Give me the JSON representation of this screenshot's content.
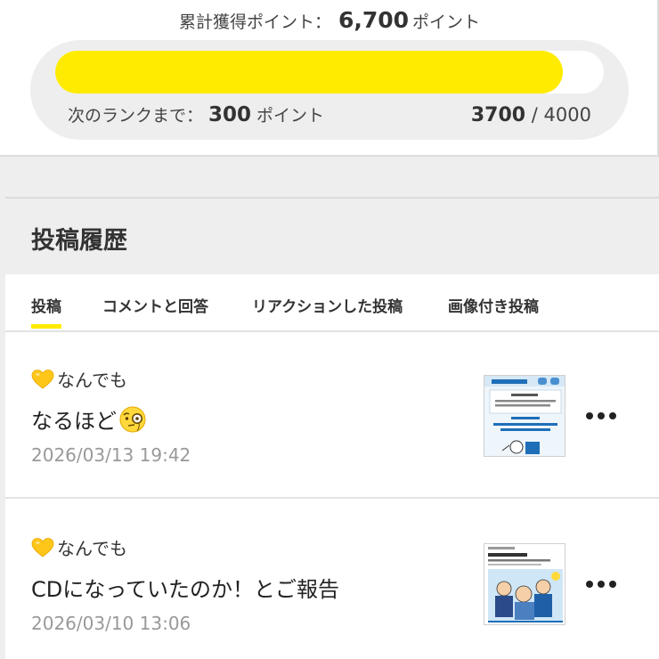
{
  "points": {
    "total_label": "累計獲得ポイント：",
    "total_value": "6,700",
    "total_unit": "ポイント",
    "next_rank_label": "次のランクまで：",
    "next_rank_value": "300",
    "next_rank_unit": "ポイント",
    "progress_current": "3700",
    "progress_separator": " / ",
    "progress_max": "4000",
    "progress_fraction": 0.925,
    "bar_color": "#ffeb00"
  },
  "history": {
    "title": "投稿履歴",
    "tabs": [
      {
        "label": "投稿",
        "active": true
      },
      {
        "label": "コメントと回答",
        "active": false
      },
      {
        "label": "リアクションした投稿",
        "active": false
      },
      {
        "label": "画像付き投稿",
        "active": false
      }
    ],
    "posts": [
      {
        "category_icon": "yellow-heart-icon",
        "category": "なんでも",
        "text": "なるほど",
        "emoji_icon": "monocle-face-icon",
        "timestamp": "2026/03/13 19:42",
        "thumb_icon": "infographic-thumbnail"
      },
      {
        "category_icon": "yellow-heart-icon",
        "category": "なんでも",
        "text": "CDになっていたのか！とご報告",
        "timestamp": "2026/03/10 13:06",
        "thumb_icon": "article-illustration-thumbnail"
      }
    ],
    "more_icon": "ellipsis-icon"
  }
}
